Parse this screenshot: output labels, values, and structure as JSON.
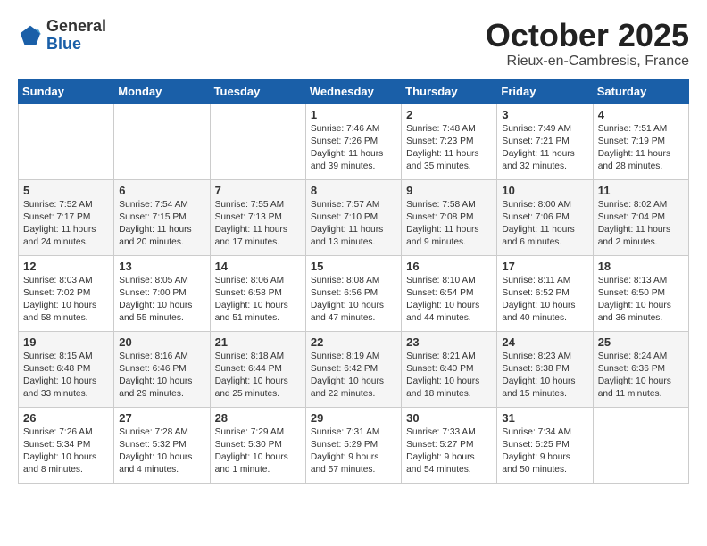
{
  "logo": {
    "general": "General",
    "blue": "Blue"
  },
  "title": "October 2025",
  "subtitle": "Rieux-en-Cambresis, France",
  "headers": [
    "Sunday",
    "Monday",
    "Tuesday",
    "Wednesday",
    "Thursday",
    "Friday",
    "Saturday"
  ],
  "weeks": [
    [
      {
        "day": "",
        "info": ""
      },
      {
        "day": "",
        "info": ""
      },
      {
        "day": "",
        "info": ""
      },
      {
        "day": "1",
        "info": "Sunrise: 7:46 AM\nSunset: 7:26 PM\nDaylight: 11 hours\nand 39 minutes."
      },
      {
        "day": "2",
        "info": "Sunrise: 7:48 AM\nSunset: 7:23 PM\nDaylight: 11 hours\nand 35 minutes."
      },
      {
        "day": "3",
        "info": "Sunrise: 7:49 AM\nSunset: 7:21 PM\nDaylight: 11 hours\nand 32 minutes."
      },
      {
        "day": "4",
        "info": "Sunrise: 7:51 AM\nSunset: 7:19 PM\nDaylight: 11 hours\nand 28 minutes."
      }
    ],
    [
      {
        "day": "5",
        "info": "Sunrise: 7:52 AM\nSunset: 7:17 PM\nDaylight: 11 hours\nand 24 minutes."
      },
      {
        "day": "6",
        "info": "Sunrise: 7:54 AM\nSunset: 7:15 PM\nDaylight: 11 hours\nand 20 minutes."
      },
      {
        "day": "7",
        "info": "Sunrise: 7:55 AM\nSunset: 7:13 PM\nDaylight: 11 hours\nand 17 minutes."
      },
      {
        "day": "8",
        "info": "Sunrise: 7:57 AM\nSunset: 7:10 PM\nDaylight: 11 hours\nand 13 minutes."
      },
      {
        "day": "9",
        "info": "Sunrise: 7:58 AM\nSunset: 7:08 PM\nDaylight: 11 hours\nand 9 minutes."
      },
      {
        "day": "10",
        "info": "Sunrise: 8:00 AM\nSunset: 7:06 PM\nDaylight: 11 hours\nand 6 minutes."
      },
      {
        "day": "11",
        "info": "Sunrise: 8:02 AM\nSunset: 7:04 PM\nDaylight: 11 hours\nand 2 minutes."
      }
    ],
    [
      {
        "day": "12",
        "info": "Sunrise: 8:03 AM\nSunset: 7:02 PM\nDaylight: 10 hours\nand 58 minutes."
      },
      {
        "day": "13",
        "info": "Sunrise: 8:05 AM\nSunset: 7:00 PM\nDaylight: 10 hours\nand 55 minutes."
      },
      {
        "day": "14",
        "info": "Sunrise: 8:06 AM\nSunset: 6:58 PM\nDaylight: 10 hours\nand 51 minutes."
      },
      {
        "day": "15",
        "info": "Sunrise: 8:08 AM\nSunset: 6:56 PM\nDaylight: 10 hours\nand 47 minutes."
      },
      {
        "day": "16",
        "info": "Sunrise: 8:10 AM\nSunset: 6:54 PM\nDaylight: 10 hours\nand 44 minutes."
      },
      {
        "day": "17",
        "info": "Sunrise: 8:11 AM\nSunset: 6:52 PM\nDaylight: 10 hours\nand 40 minutes."
      },
      {
        "day": "18",
        "info": "Sunrise: 8:13 AM\nSunset: 6:50 PM\nDaylight: 10 hours\nand 36 minutes."
      }
    ],
    [
      {
        "day": "19",
        "info": "Sunrise: 8:15 AM\nSunset: 6:48 PM\nDaylight: 10 hours\nand 33 minutes."
      },
      {
        "day": "20",
        "info": "Sunrise: 8:16 AM\nSunset: 6:46 PM\nDaylight: 10 hours\nand 29 minutes."
      },
      {
        "day": "21",
        "info": "Sunrise: 8:18 AM\nSunset: 6:44 PM\nDaylight: 10 hours\nand 25 minutes."
      },
      {
        "day": "22",
        "info": "Sunrise: 8:19 AM\nSunset: 6:42 PM\nDaylight: 10 hours\nand 22 minutes."
      },
      {
        "day": "23",
        "info": "Sunrise: 8:21 AM\nSunset: 6:40 PM\nDaylight: 10 hours\nand 18 minutes."
      },
      {
        "day": "24",
        "info": "Sunrise: 8:23 AM\nSunset: 6:38 PM\nDaylight: 10 hours\nand 15 minutes."
      },
      {
        "day": "25",
        "info": "Sunrise: 8:24 AM\nSunset: 6:36 PM\nDaylight: 10 hours\nand 11 minutes."
      }
    ],
    [
      {
        "day": "26",
        "info": "Sunrise: 7:26 AM\nSunset: 5:34 PM\nDaylight: 10 hours\nand 8 minutes."
      },
      {
        "day": "27",
        "info": "Sunrise: 7:28 AM\nSunset: 5:32 PM\nDaylight: 10 hours\nand 4 minutes."
      },
      {
        "day": "28",
        "info": "Sunrise: 7:29 AM\nSunset: 5:30 PM\nDaylight: 10 hours\nand 1 minute."
      },
      {
        "day": "29",
        "info": "Sunrise: 7:31 AM\nSunset: 5:29 PM\nDaylight: 9 hours\nand 57 minutes."
      },
      {
        "day": "30",
        "info": "Sunrise: 7:33 AM\nSunset: 5:27 PM\nDaylight: 9 hours\nand 54 minutes."
      },
      {
        "day": "31",
        "info": "Sunrise: 7:34 AM\nSunset: 5:25 PM\nDaylight: 9 hours\nand 50 minutes."
      },
      {
        "day": "",
        "info": ""
      }
    ]
  ]
}
